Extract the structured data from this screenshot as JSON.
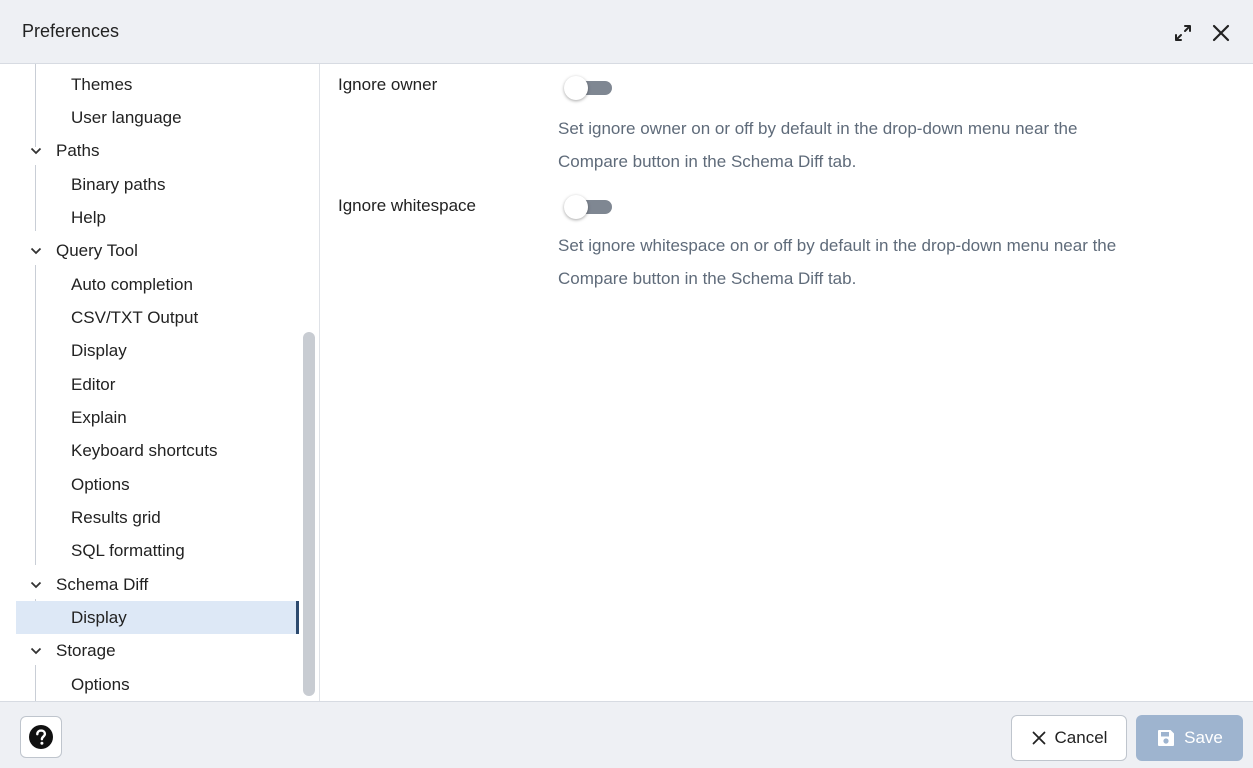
{
  "dialog": {
    "title": "Preferences"
  },
  "sidebar": {
    "items": [
      {
        "label": "Themes",
        "level": "child"
      },
      {
        "label": "User language",
        "level": "child"
      },
      {
        "label": "Paths",
        "level": "parent"
      },
      {
        "label": "Binary paths",
        "level": "child"
      },
      {
        "label": "Help",
        "level": "child"
      },
      {
        "label": "Query Tool",
        "level": "parent"
      },
      {
        "label": "Auto completion",
        "level": "child"
      },
      {
        "label": "CSV/TXT Output",
        "level": "child"
      },
      {
        "label": "Display",
        "level": "child"
      },
      {
        "label": "Editor",
        "level": "child"
      },
      {
        "label": "Explain",
        "level": "child"
      },
      {
        "label": "Keyboard shortcuts",
        "level": "child"
      },
      {
        "label": "Options",
        "level": "child"
      },
      {
        "label": "Results grid",
        "level": "child"
      },
      {
        "label": "SQL formatting",
        "level": "child"
      },
      {
        "label": "Schema Diff",
        "level": "parent"
      },
      {
        "label": "Display",
        "level": "child",
        "selected": true
      },
      {
        "label": "Storage",
        "level": "parent"
      },
      {
        "label": "Options",
        "level": "child"
      }
    ]
  },
  "settings": {
    "ignore_owner": {
      "label": "Ignore owner",
      "enabled": false,
      "help_line1": "Set ignore owner on or off by default in the drop-down menu near the",
      "help_line2": "Compare button in the Schema Diff tab."
    },
    "ignore_whitespace": {
      "label": "Ignore whitespace",
      "enabled": false,
      "help_line1": "Set ignore whitespace on or off by default in the drop-down menu near the",
      "help_line2": "Compare button in the Schema Diff tab."
    }
  },
  "footer": {
    "help_icon": "question-circle-icon",
    "cancel_label": "Cancel",
    "save_label": "Save",
    "save_enabled": false
  },
  "colors": {
    "selected_bg": "#dde8f6",
    "save_button": "#9eb4cf",
    "toggle_off": "#7f8792"
  }
}
